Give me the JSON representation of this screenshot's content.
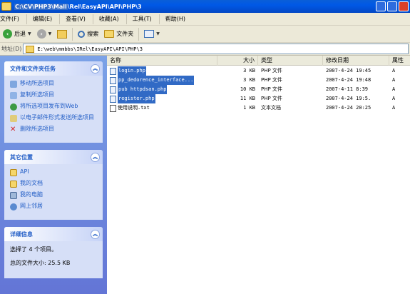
{
  "window": {
    "title_hl": "C:\\CV\\PHP3\\Mall",
    "title_rest": "\\Rel\\EasyAPI\\API\\PHP\\3"
  },
  "menu": [
    "文件(F)",
    "编辑(E)",
    "查看(V)",
    "收藏(A)",
    "工具(T)",
    "帮助(H)"
  ],
  "toolbar": {
    "back": "后退",
    "search": "搜索",
    "folders": "文件夹"
  },
  "address": {
    "label": "地址(D)",
    "path": "E:\\web\\mmbbs\\IRel\\EasyAPI\\API\\PHP\\3"
  },
  "tasks_panel": {
    "title": "文件和文件夹任务",
    "items": [
      "移动所选项目",
      "复制所选项目",
      "将所选项目发布到Web",
      "以电子邮件形式发送所选项目",
      "删除所选项目"
    ]
  },
  "places_panel": {
    "title": "其它位置",
    "items": [
      "API",
      "我的文档",
      "我的电脑",
      "网上邻居"
    ]
  },
  "details_panel": {
    "title": "详细信息",
    "selected": "选择了 4 个项目。",
    "total_size": "总的文件大小: 25.5 KB"
  },
  "columns": {
    "name": "名称",
    "size": "大小",
    "type": "类型",
    "modified": "修改日期",
    "attr": "属性"
  },
  "files": [
    {
      "name": "login.php",
      "size": "3 KB",
      "type": "PHP 文件",
      "modified": "2007-4-24 19:45",
      "attr": "A",
      "selected": true,
      "icon": "php-file-icon"
    },
    {
      "name": "pp_dedorence_interface...",
      "size": "3 KB",
      "type": "PHP 文件",
      "modified": "2007-4-24 19:48",
      "attr": "A",
      "selected": true,
      "icon": "php-file-icon"
    },
    {
      "name": "pub httpdsan.php",
      "size": "10 KB",
      "type": "PHP 文件",
      "modified": "2007-4-11 8:39",
      "attr": "A",
      "selected": true,
      "icon": "php-file-icon"
    },
    {
      "name": "register.php",
      "size": "11 KB",
      "type": "PHP 文件",
      "modified": "2007-4-24 19:5.",
      "attr": "A",
      "selected": true,
      "icon": "php-file-icon"
    },
    {
      "name": "使用说明.txt",
      "size": "1 KB",
      "type": "文本文档",
      "modified": "2007-4-24 20:25",
      "attr": "A",
      "selected": false,
      "icon": "text-file-icon"
    }
  ],
  "colors": {
    "title_blue": "#0058e6",
    "pane_top": "#7ba2e7",
    "pane_bottom": "#6375d6",
    "link": "#215dc6",
    "selection": "#316ac5"
  }
}
